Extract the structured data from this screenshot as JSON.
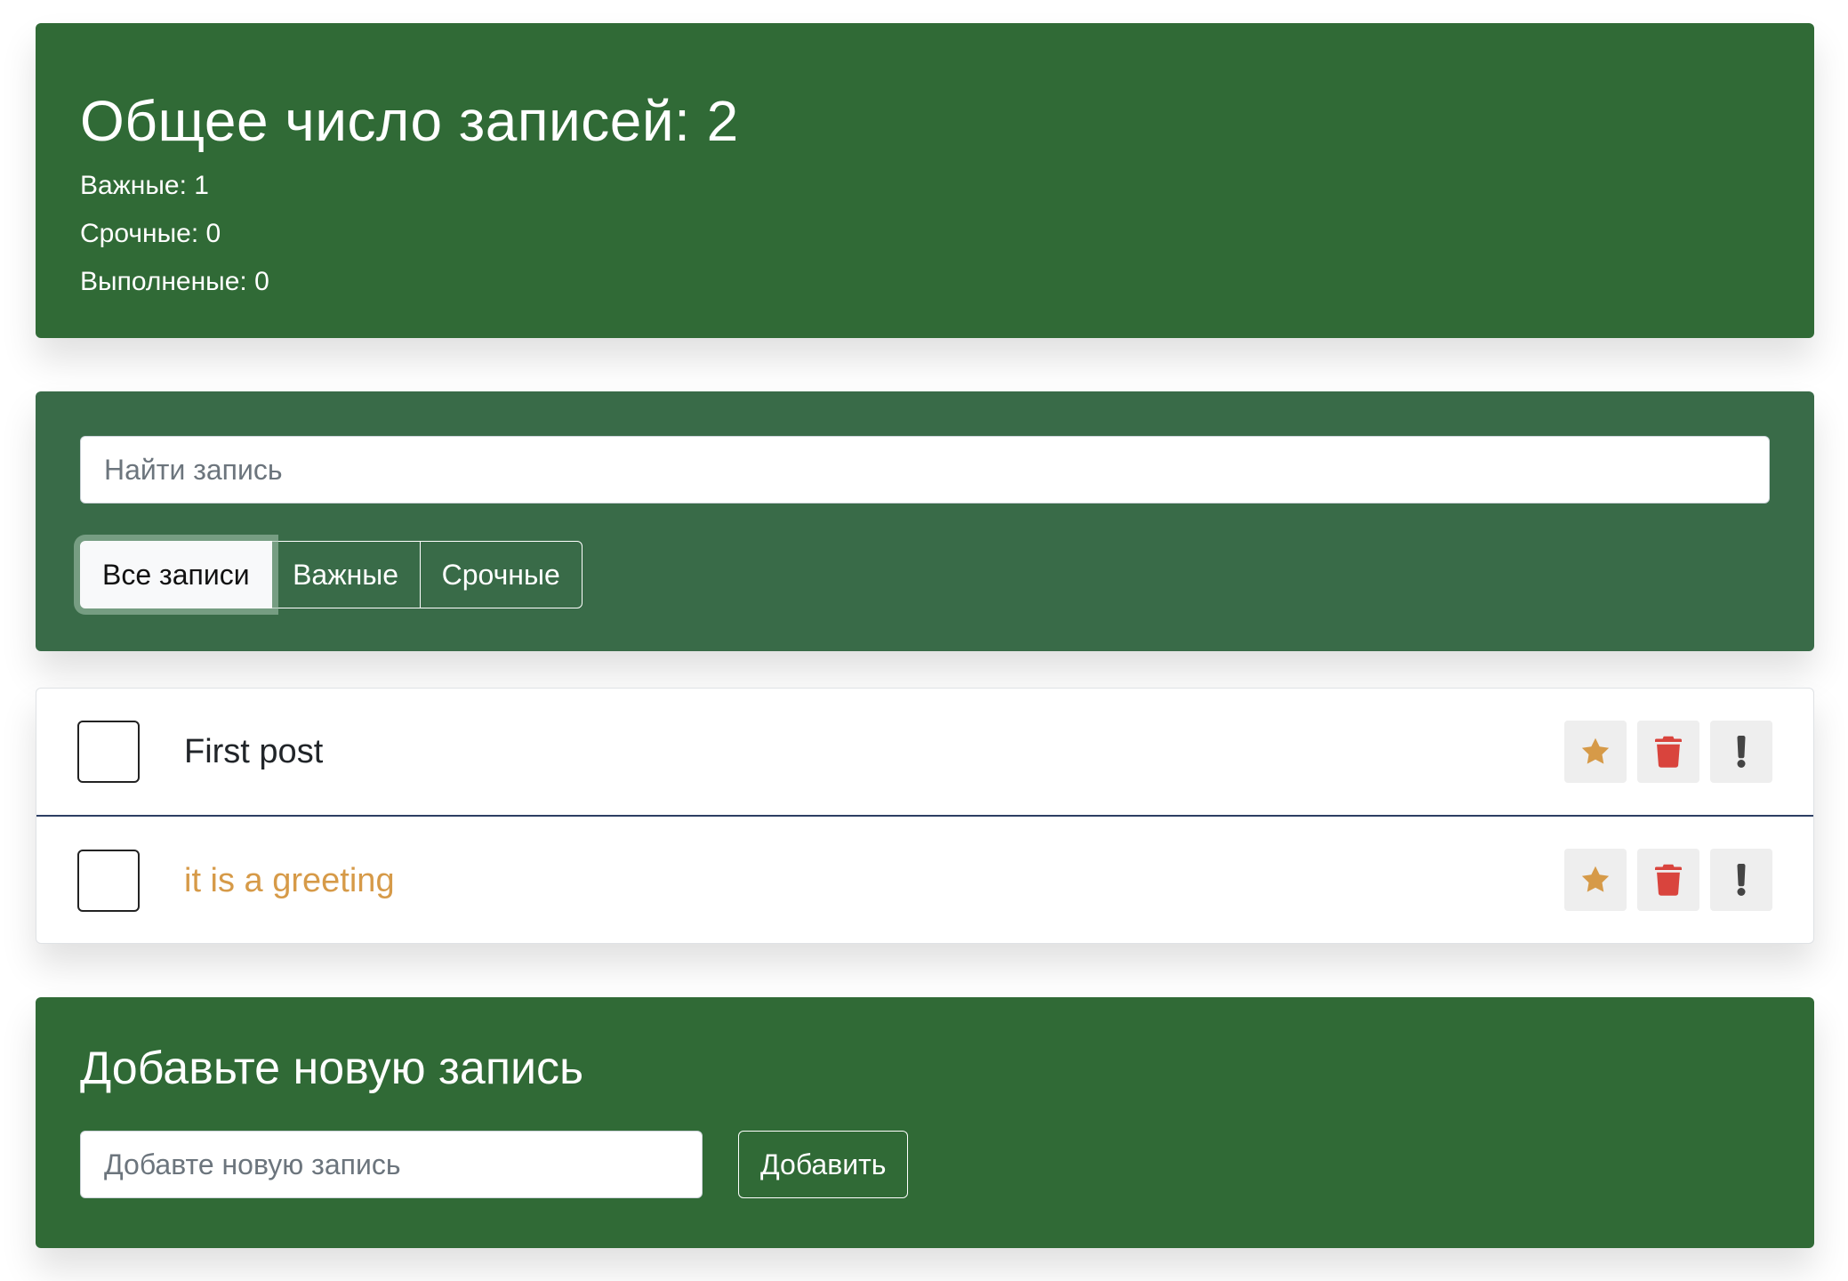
{
  "stats": {
    "title": "Общее число записей: 2",
    "important": "Важные: 1",
    "urgent": "Срочные: 0",
    "done": "Выполненые: 0"
  },
  "search": {
    "placeholder": "Найти запись",
    "value": ""
  },
  "filters": [
    {
      "label": "Все записи",
      "active": true
    },
    {
      "label": "Важные",
      "active": false
    },
    {
      "label": "Срочные",
      "active": false
    }
  ],
  "posts": [
    {
      "label": "First post",
      "important": false,
      "checked": false
    },
    {
      "label": "it is a greeting",
      "important": true,
      "checked": false
    }
  ],
  "actions": {
    "star_icon": "star-icon",
    "delete_icon": "trash-icon",
    "urgent_icon": "exclamation-icon"
  },
  "add_form": {
    "title": "Добавьте новую запись",
    "placeholder": "Добавте новую запись",
    "value": "",
    "button_label": "Добавить"
  },
  "colors": {
    "header_bg": "#306a36",
    "search_bg": "#396b48",
    "important_text": "#d69a48",
    "star": "#d69a48",
    "trash": "#d9443d",
    "exclamation": "#444444"
  }
}
